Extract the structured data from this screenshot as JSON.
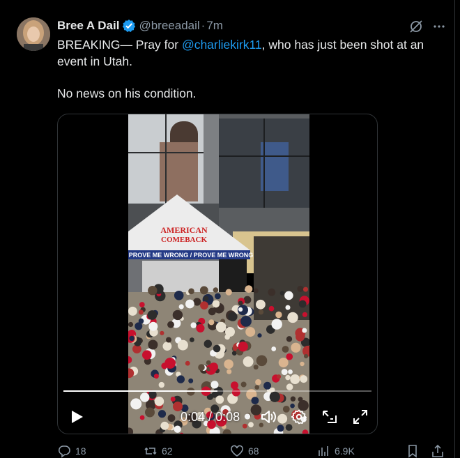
{
  "tweet": {
    "author_name": "Bree A Dail",
    "handle": "@breeadail",
    "separator": "·",
    "time": "7m",
    "text_pre": "BREAKING— Pray for ",
    "mention": "@charliekirk11",
    "text_post": ", who has just been shot at an event in Utah.",
    "text_line2": "No news on his condition."
  },
  "video": {
    "current_time": "0:04",
    "divider": " / ",
    "duration": "0:08",
    "progress": 0.5,
    "tent_text_1": "AMERICAN",
    "tent_text_2": "COMEBACK",
    "banner_text": "PROVE ME WRONG / PROVE ME WRONG"
  },
  "actions": {
    "replies": "18",
    "reposts": "62",
    "likes": "68",
    "views": "6.9K"
  },
  "icons": [
    "verified-badge-icon",
    "grok-icon",
    "more-icon",
    "play-icon",
    "volume-icon",
    "settings-icon",
    "pip-icon",
    "fullscreen-icon",
    "reply-icon",
    "repost-icon",
    "like-icon",
    "views-icon",
    "bookmark-icon",
    "share-icon"
  ],
  "colors": {
    "accent": "#1d9bf0",
    "muted": "#8b98a5",
    "background": "#000000"
  }
}
